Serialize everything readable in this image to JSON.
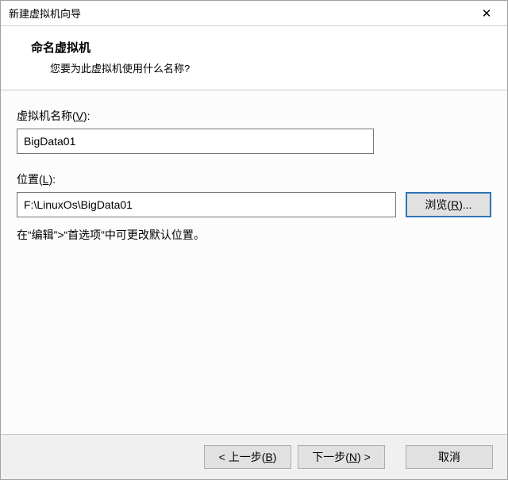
{
  "titlebar": {
    "title": "新建虚拟机向导"
  },
  "header": {
    "title": "命名虚拟机",
    "subtitle": "您要为此虚拟机使用什么名称?"
  },
  "form": {
    "name_label_prefix": "虚拟机名称(",
    "name_label_key": "V",
    "name_label_suffix": "):",
    "name_value": "BigData01",
    "location_label_prefix": "位置(",
    "location_label_key": "L",
    "location_label_suffix": "):",
    "location_value": "F:\\LinuxOs\\BigData01",
    "browse_prefix": "浏览(",
    "browse_key": "R",
    "browse_suffix": ")...",
    "hint": "在“编辑”>“首选项”中可更改默认位置。"
  },
  "footer": {
    "back_prefix": "< 上一步(",
    "back_key": "B",
    "back_suffix": ")",
    "next_prefix": "下一步(",
    "next_key": "N",
    "next_suffix": ") >",
    "cancel": "取消"
  }
}
